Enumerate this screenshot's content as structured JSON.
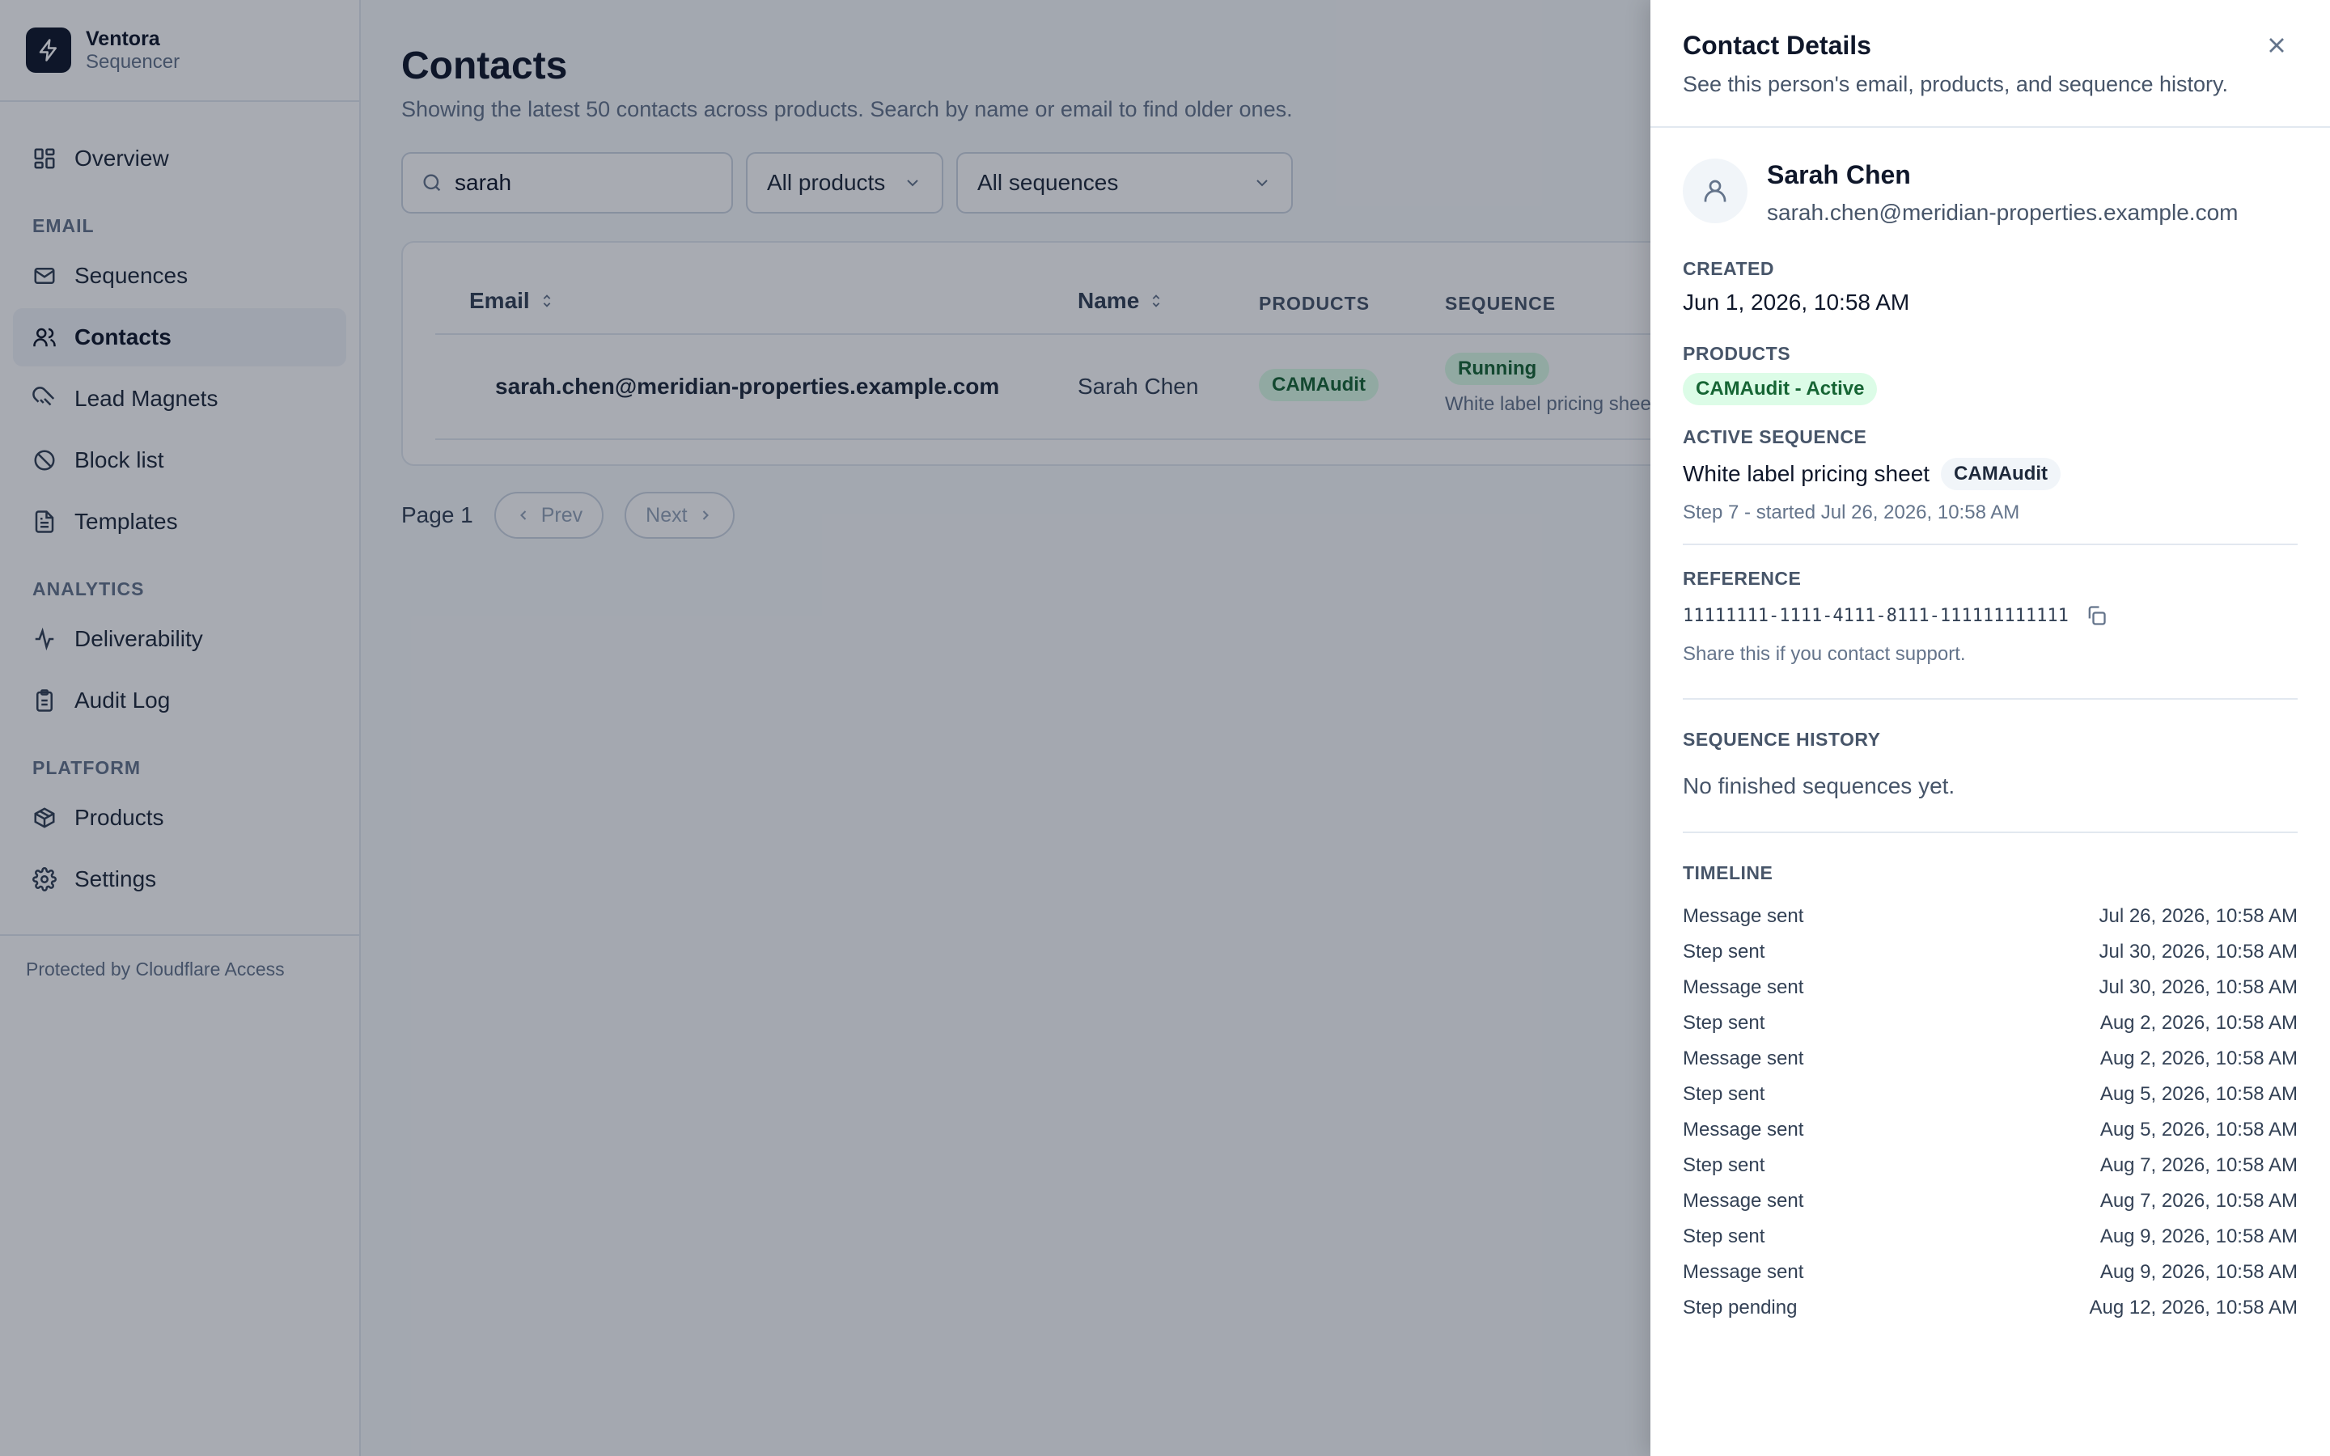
{
  "brand": {
    "name": "Ventora",
    "sub": "Sequencer"
  },
  "nav": {
    "overview": "Overview",
    "email_section": "EMAIL",
    "sequences": "Sequences",
    "contacts": "Contacts",
    "lead_magnets": "Lead Magnets",
    "block_list": "Block list",
    "templates": "Templates",
    "analytics_section": "ANALYTICS",
    "deliverability": "Deliverability",
    "audit_log": "Audit Log",
    "platform_section": "PLATFORM",
    "products": "Products",
    "settings": "Settings",
    "footer": "Protected by Cloudflare Access"
  },
  "page": {
    "title": "Contacts",
    "subtitle": "Showing the latest 50 contacts across products. Search by name or email to find older ones."
  },
  "filters": {
    "search_value": "sarah",
    "products_selected": "All products",
    "sequences_selected": "All sequences"
  },
  "table": {
    "headers": {
      "email": "Email",
      "name": "Name",
      "products": "PRODUCTS",
      "sequence": "SEQUENCE"
    },
    "rows": [
      {
        "email": "sarah.chen@meridian-properties.example.com",
        "name": "Sarah Chen",
        "product": "CAMAudit",
        "status": "Running",
        "sequence": "White label pricing sheet"
      }
    ]
  },
  "pager": {
    "label": "Page 1",
    "prev": "Prev",
    "next": "Next"
  },
  "drawer": {
    "title": "Contact Details",
    "subtitle": "See this person's email, products, and sequence history.",
    "name": "Sarah Chen",
    "email": "sarah.chen@meridian-properties.example.com",
    "created_label": "CREATED",
    "created_value": "Jun 1, 2026, 10:58 AM",
    "products_label": "PRODUCTS",
    "products_badge": "CAMAudit - Active",
    "active_seq_label": "ACTIVE SEQUENCE",
    "active_seq_name": "White label pricing sheet",
    "active_seq_badge": "CAMAudit",
    "active_seq_step": "Step 7 - started Jul 26, 2026, 10:58 AM",
    "reference_label": "REFERENCE",
    "reference_value": "11111111-1111-4111-8111-111111111111",
    "reference_help": "Share this if you contact support.",
    "history_label": "SEQUENCE HISTORY",
    "history_empty": "No finished sequences yet.",
    "timeline_label": "TIMELINE",
    "timeline": [
      {
        "event": "Message sent",
        "date": "Jul 26, 2026, 10:58 AM"
      },
      {
        "event": "Step sent",
        "date": "Jul 30, 2026, 10:58 AM"
      },
      {
        "event": "Message sent",
        "date": "Jul 30, 2026, 10:58 AM"
      },
      {
        "event": "Step sent",
        "date": "Aug 2, 2026, 10:58 AM"
      },
      {
        "event": "Message sent",
        "date": "Aug 2, 2026, 10:58 AM"
      },
      {
        "event": "Step sent",
        "date": "Aug 5, 2026, 10:58 AM"
      },
      {
        "event": "Message sent",
        "date": "Aug 5, 2026, 10:58 AM"
      },
      {
        "event": "Step sent",
        "date": "Aug 7, 2026, 10:58 AM"
      },
      {
        "event": "Message sent",
        "date": "Aug 7, 2026, 10:58 AM"
      },
      {
        "event": "Step sent",
        "date": "Aug 9, 2026, 10:58 AM"
      },
      {
        "event": "Message sent",
        "date": "Aug 9, 2026, 10:58 AM"
      },
      {
        "event": "Step pending",
        "date": "Aug 12, 2026, 10:58 AM"
      }
    ]
  }
}
